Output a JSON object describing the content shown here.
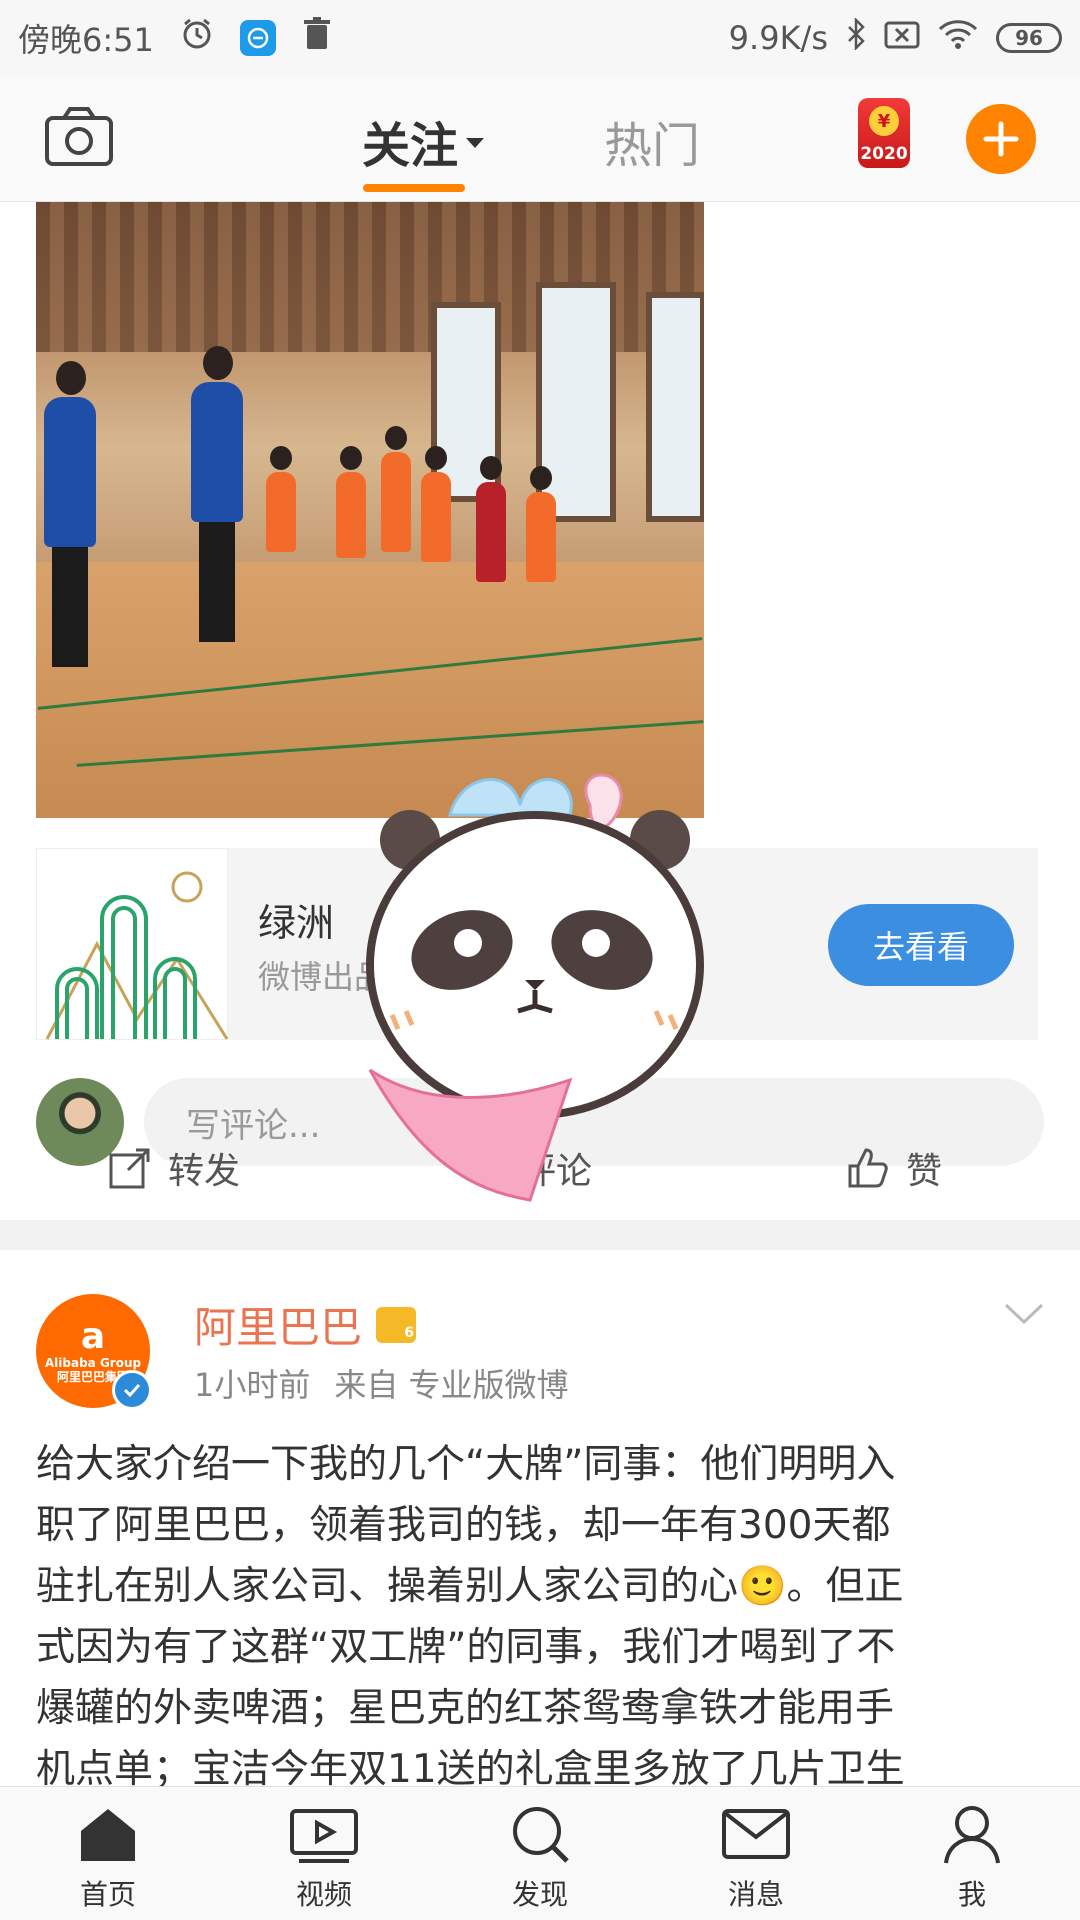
{
  "status_bar": {
    "time": "傍晚6:51",
    "net_speed": "9.9K/s",
    "battery": "96",
    "icons": [
      "alarm-icon",
      "app-notification-icon",
      "trash-icon",
      "bluetooth-icon",
      "sim-x-icon",
      "wifi-icon",
      "battery-icon"
    ]
  },
  "top_nav": {
    "tabs": [
      {
        "label": "关注"
      },
      {
        "label": "热门"
      }
    ],
    "redpacket_year": "2020",
    "redpacket_symbol": "¥"
  },
  "promo_card": {
    "name": "绿洲",
    "subtitle": "微博出品",
    "button": "去看看"
  },
  "comment_box": {
    "placeholder": "写评论..."
  },
  "actions": {
    "repost": "转发",
    "comment": "评论",
    "like": "赞"
  },
  "post": {
    "author": "阿里巴巴",
    "avatar_text_big": "Alibaba Group",
    "avatar_text_small": "阿里巴巴集团",
    "level_badge": "6",
    "time": "1小时前",
    "source": "来自 专业版微博",
    "body_lines": [
      "给大家介绍一下我的几个“大牌”同事：他们明明入",
      "职了阿里巴巴，领着我司的钱，却一年有300天都",
      "驻扎在别人家公司、操着别人家公司的心🙂。但正",
      "式因为有了这群“双工牌”的同事，我们才喝到了不",
      "爆罐的外卖啤酒；星巴克的红茶鸳鸯拿铁才能用手",
      "机点单；宝洁今年双11送的礼盒里多放了几片卫生"
    ]
  },
  "bottom_nav": {
    "items": [
      {
        "label": "首页",
        "icon": "home-icon"
      },
      {
        "label": "视频",
        "icon": "video-icon"
      },
      {
        "label": "发现",
        "icon": "search-icon"
      },
      {
        "label": "消息",
        "icon": "mail-icon"
      },
      {
        "label": "我",
        "icon": "profile-icon"
      }
    ]
  },
  "colors": {
    "accent": "#ff8200",
    "author": "#eb7350",
    "button_blue": "#3b8ee0"
  }
}
